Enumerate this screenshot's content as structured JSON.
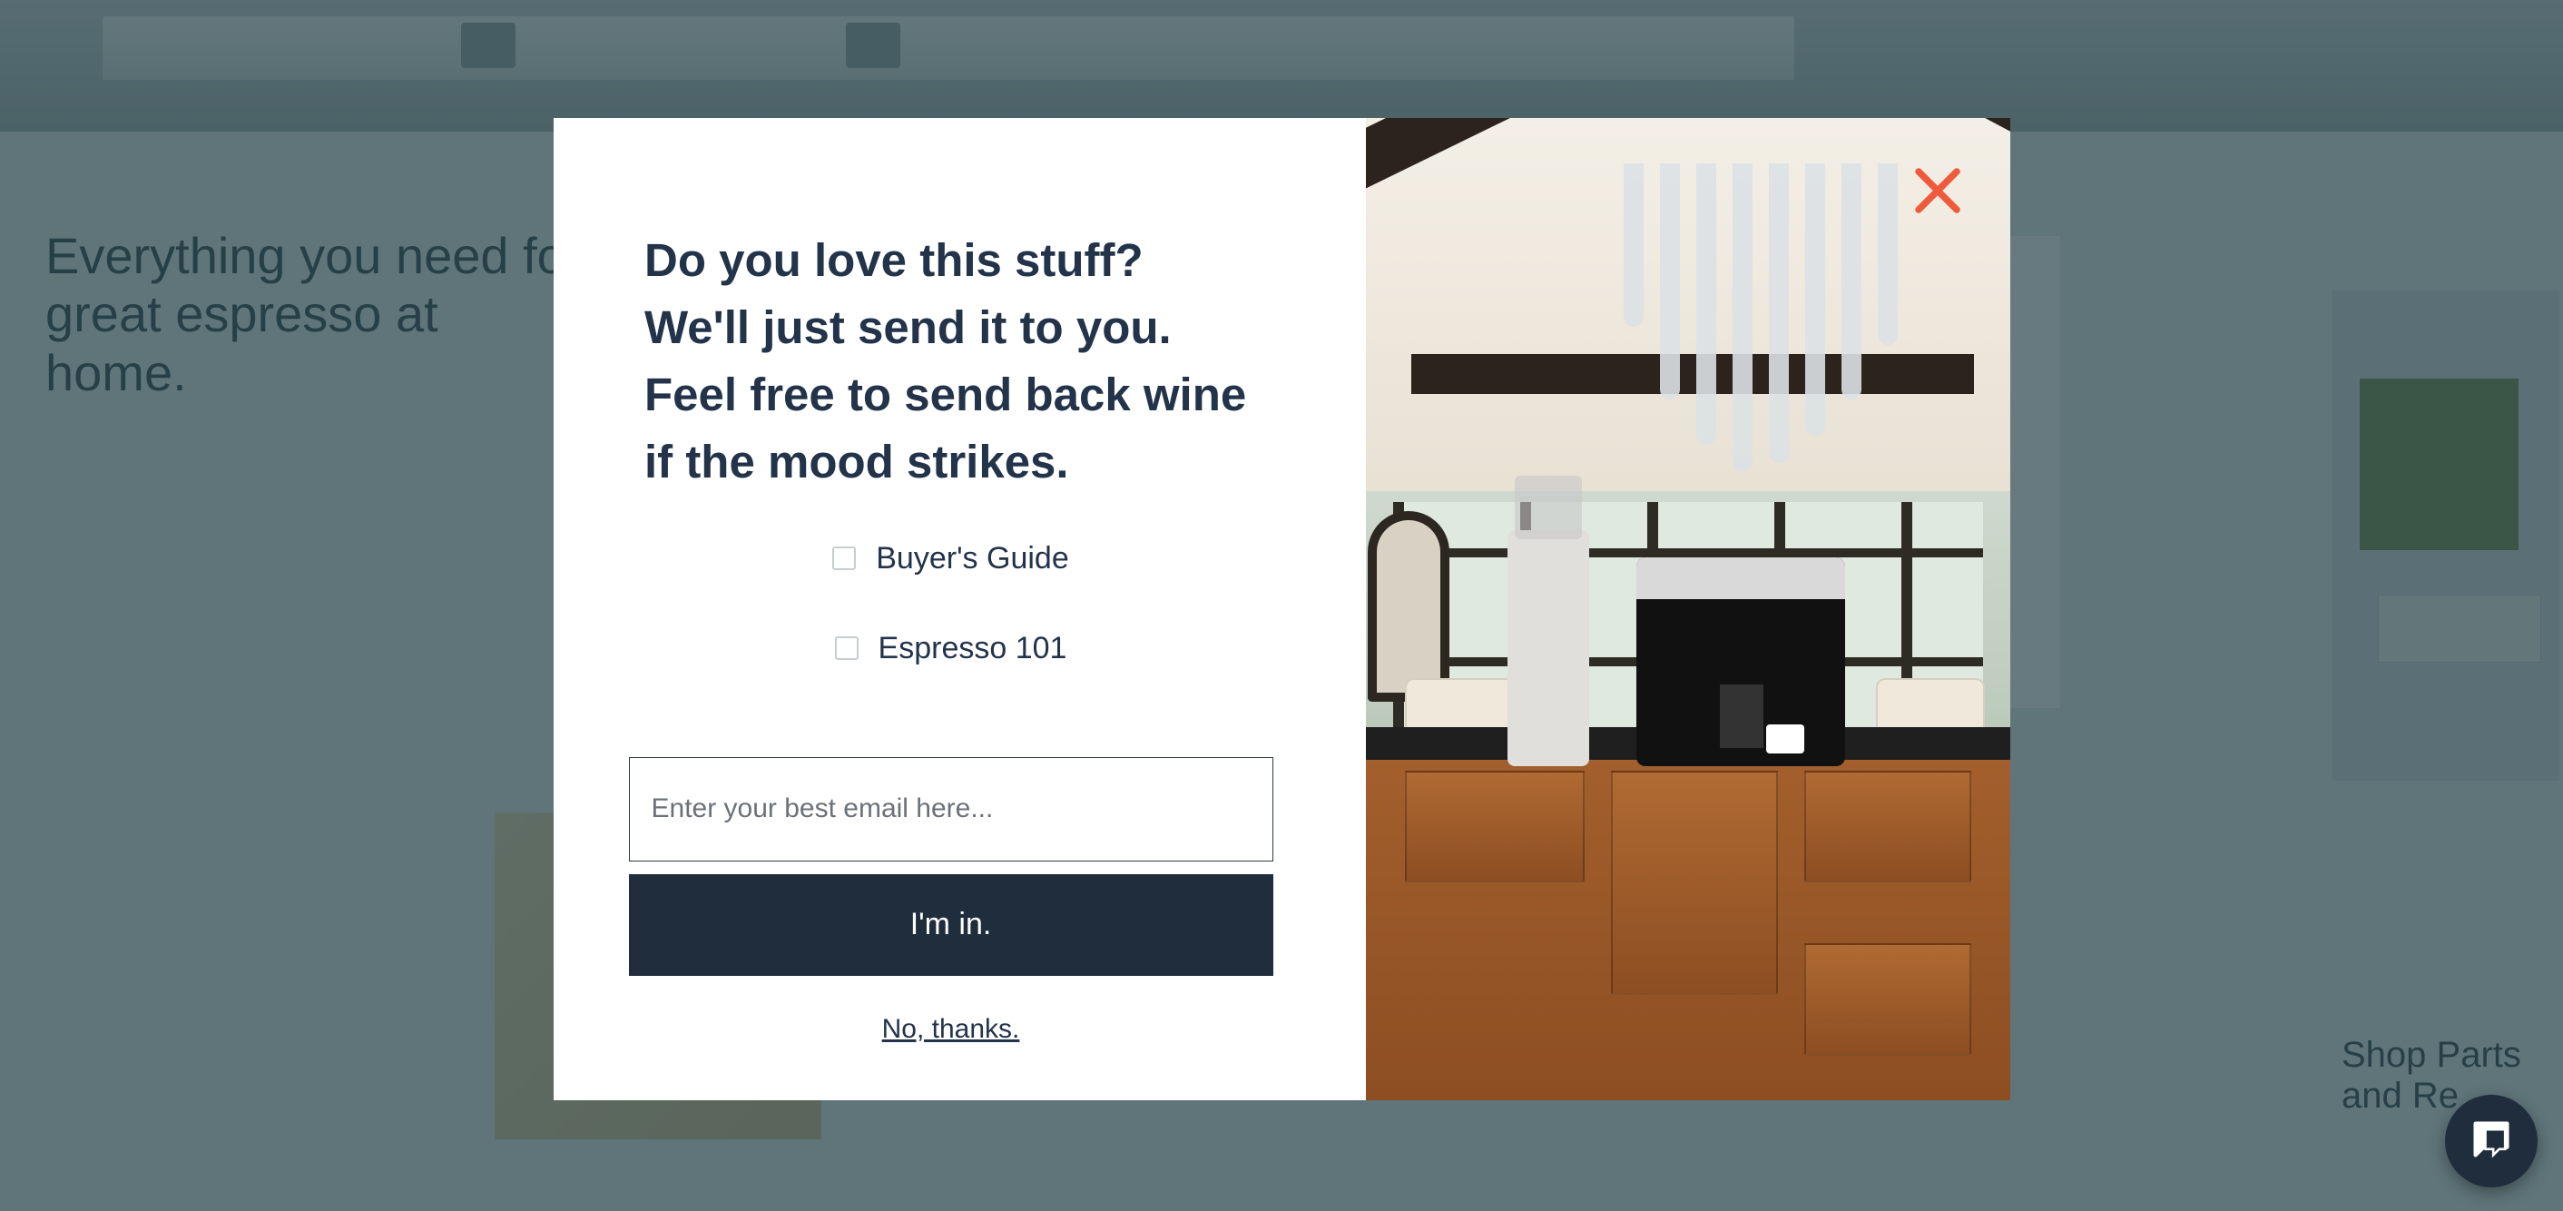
{
  "background": {
    "headline": "Everything you need for great espresso at home.",
    "product_caption": "Shop Parts and Re"
  },
  "modal": {
    "title": "Do you love this stuff? We'll just send it to you. Feel free to send back wine if the mood strikes.",
    "checkboxes": [
      {
        "label": "Buyer's Guide"
      },
      {
        "label": "Espresso 101"
      }
    ],
    "email_placeholder": "Enter your best email here...",
    "submit_label": "I'm in.",
    "dismiss_label": "No, thanks.",
    "close_icon": "close-icon"
  },
  "chat": {
    "icon": "chat-icon"
  },
  "colors": {
    "modal_title": "#22334a",
    "submit_bg": "#1f2d3d",
    "close_x": "#ef5a3c",
    "overlay": "rgba(30,59,66,0.68)"
  }
}
